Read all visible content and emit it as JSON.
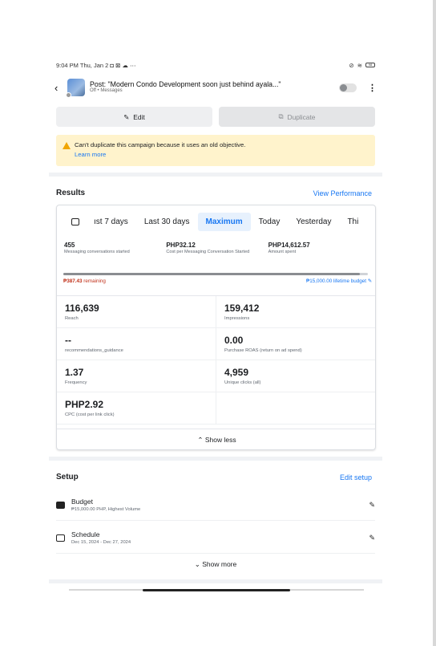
{
  "status_bar": {
    "time_date": "9:04 PM Thu, Jan 2",
    "notif_icons": "◘ ⊠ ☁ ⋯",
    "battery": "98"
  },
  "header": {
    "back_glyph": "‹",
    "title": "Post: \"Modern Condo  Development soon just behind ayala...\"",
    "subtitle": "Off • Messages",
    "kebab_glyph": "⋮"
  },
  "actions": {
    "edit_label": "Edit",
    "edit_icon_glyph": "✎",
    "duplicate_label": "Duplicate",
    "duplicate_icon_glyph": "⧉"
  },
  "warning": {
    "message": "Can't duplicate this campaign because it uses an old objective.",
    "link": "Learn more"
  },
  "results": {
    "title": "Results",
    "link": "View Performance",
    "tabs": [
      "ıst 7 days",
      "Last 30 days",
      "Maximum",
      "Today",
      "Yesterday",
      "Thi"
    ],
    "active_tab": "Maximum",
    "top_metrics": [
      {
        "value": "455",
        "label": "Messaging conversations started"
      },
      {
        "value": "PHP32.12",
        "label": "Cost per Messaging Conversation Started"
      },
      {
        "value": "PHP14,612.57",
        "label": "Amount spent"
      }
    ],
    "budget_progress": 0.974,
    "remaining_amount": "₱387.43",
    "remaining_label": "remaining",
    "lifetime_budget": "₱15,000.00 lifetime budget",
    "lifetime_icon_glyph": "✎",
    "grid": [
      [
        {
          "value": "116,639",
          "label": "Reach"
        },
        {
          "value": "159,412",
          "label": "Impressions"
        }
      ],
      [
        {
          "value": "--",
          "label": "recommendations_guidance"
        },
        {
          "value": "0.00",
          "label": "Purchase ROAS (return on ad spend)"
        }
      ],
      [
        {
          "value": "1.37",
          "label": "Frequency"
        },
        {
          "value": "4,959",
          "label": "Unique clicks (all)"
        }
      ],
      [
        {
          "value": "PHP2.92",
          "label": "CPC (cost per link click)"
        },
        {
          "value": "",
          "label": ""
        }
      ]
    ],
    "show_less": "Show less",
    "show_less_glyph": "⌃"
  },
  "setup": {
    "title": "Setup",
    "link": "Edit setup",
    "items": [
      {
        "title": "Budget",
        "subtitle": "₱15,000.00 PHP, Highest Volume",
        "icon": "credit-card-icon"
      },
      {
        "title": "Schedule",
        "subtitle": "Dec 15, 2024 - Dec 27, 2024",
        "icon": "calendar-icon"
      }
    ],
    "pencil_glyph": "✎",
    "show_more": "Show more",
    "show_more_glyph": "⌄"
  },
  "colors": {
    "accent": "#1877f2",
    "warning_bg": "#fff3cc",
    "warning_icon": "#f0a500",
    "remaining_red": "#c1311a"
  }
}
